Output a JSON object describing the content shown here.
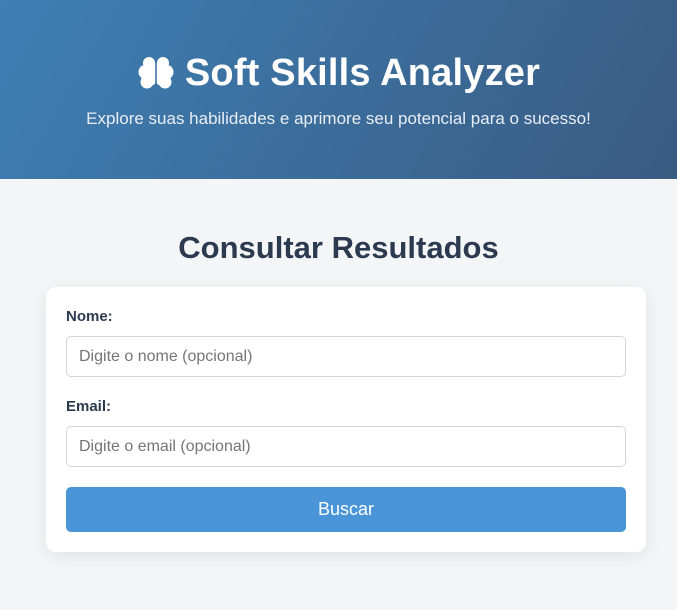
{
  "header": {
    "icon": "brain-icon",
    "title": "Soft Skills Analyzer",
    "subtitle": "Explore suas habilidades e aprimore seu potencial para o sucesso!"
  },
  "main": {
    "section_title": "Consultar Resultados",
    "form": {
      "name_label": "Nome:",
      "name_value": "",
      "name_placeholder": "Digite o nome (opcional)",
      "email_label": "Email:",
      "email_value": "",
      "email_placeholder": "Digite o email (opcional)",
      "submit_label": "Buscar"
    }
  },
  "colors": {
    "header_gradient_start": "#3f7fb4",
    "header_gradient_end": "#3a5b82",
    "button": "#4a95d8",
    "heading_text": "#2c3a4f",
    "background": "#f3f5f7"
  }
}
